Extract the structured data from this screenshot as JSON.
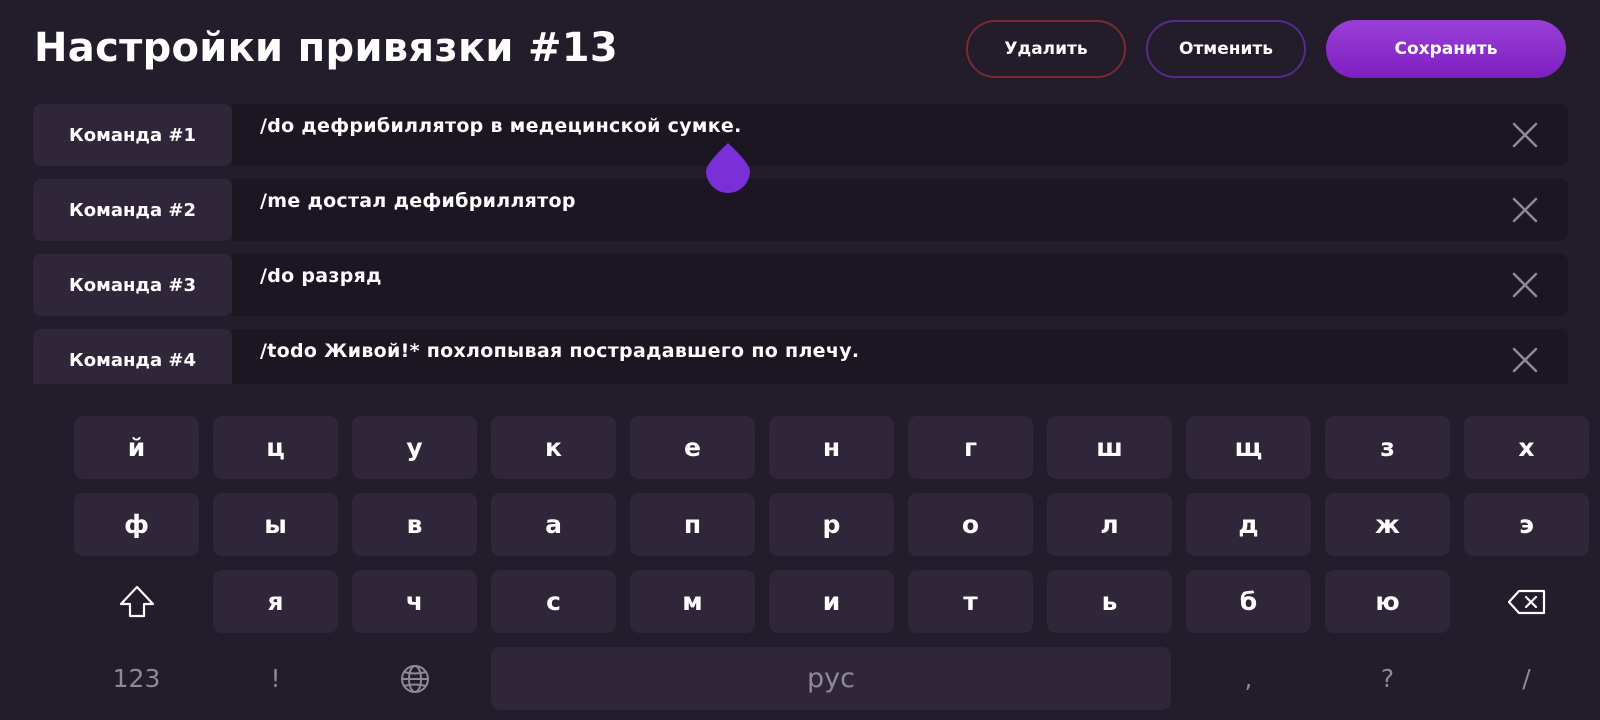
{
  "header": {
    "title": "Настройки привязки #13",
    "delete_label": "Удалить",
    "cancel_label": "Отменить",
    "save_label": "Сохранить"
  },
  "commands": [
    {
      "label": "Команда #1",
      "value": "/do дефрибиллятор в медецинской сумке."
    },
    {
      "label": "Команда #2",
      "value": "/me достал дефибриллятор"
    },
    {
      "label": "Команда #3",
      "value": "/do разряд"
    },
    {
      "label": "Команда #4",
      "value": "/todo Живой!* похлопывая пострадавшего по плечу."
    }
  ],
  "keyboard": {
    "row1": [
      "й",
      "ц",
      "у",
      "к",
      "е",
      "н",
      "г",
      "ш",
      "щ",
      "з",
      "х"
    ],
    "row2": [
      "ф",
      "ы",
      "в",
      "а",
      "п",
      "р",
      "о",
      "л",
      "д",
      "ж",
      "э"
    ],
    "row3": [
      "я",
      "ч",
      "с",
      "м",
      "и",
      "т",
      "ь",
      "б",
      "ю"
    ],
    "row4": {
      "numbers": "123",
      "exclaim": "!",
      "space": "рус",
      "comma": ",",
      "question": "?",
      "slash": "/"
    },
    "icons": {
      "shift": "shift-icon",
      "backspace": "backspace-icon",
      "language": "globe-icon"
    }
  },
  "colors": {
    "background": "#221c2b",
    "accent": "#8a2be2",
    "delete_border": "#7a2a35",
    "cancel_border": "#5a2a8a"
  }
}
